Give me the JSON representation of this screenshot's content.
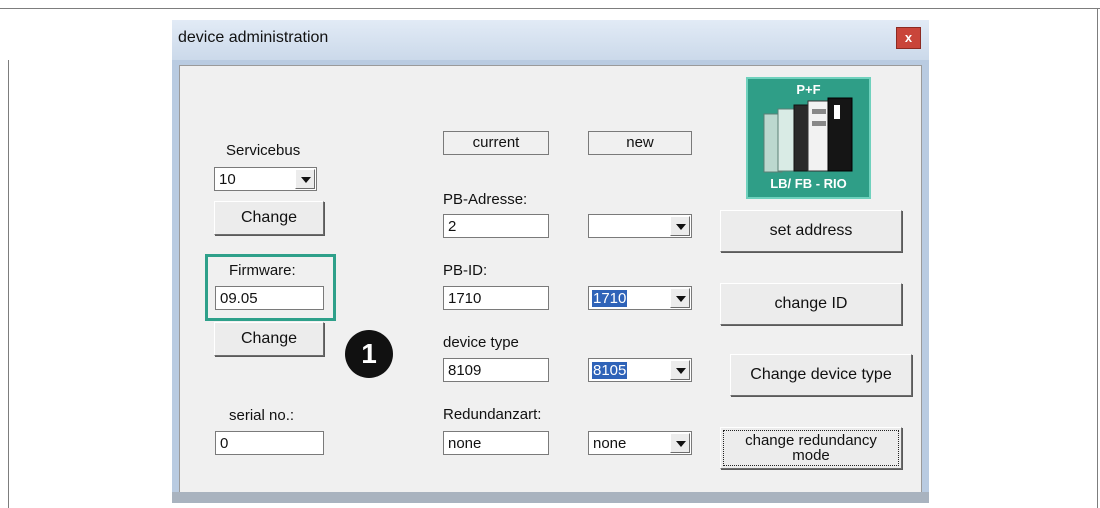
{
  "window": {
    "title": "device administration",
    "close_glyph": "x"
  },
  "left": {
    "servicebus_label": "Servicebus",
    "servicebus_value": "10",
    "change1_label": "Change",
    "firmware_label": "Firmware:",
    "firmware_value": "09.05",
    "change2_label": "Change",
    "serial_label": "serial no.:",
    "serial_value": "0"
  },
  "columns": {
    "current": "current",
    "new": "new"
  },
  "pb_address": {
    "label": "PB-Adresse:",
    "current": "2",
    "new": ""
  },
  "pb_id": {
    "label": "PB-ID:",
    "current": "1710",
    "new": "1710"
  },
  "device_type": {
    "label": "device type",
    "current": "8109",
    "new": "8105"
  },
  "redundancy": {
    "label": "Redundanzart:",
    "current": "none",
    "new": "none"
  },
  "buttons": {
    "set_address": "set address",
    "change_id": "change ID",
    "change_device_type": "Change device type",
    "change_redundancy": "change redundancy mode"
  },
  "logo": {
    "top_text": "P+F",
    "bottom_text": "LB/ FB - RIO"
  },
  "marker": {
    "number": "1"
  },
  "colors": {
    "highlight": "#2ea08a",
    "logo_bg": "#2f9e87",
    "selection": "#2f63b8"
  }
}
